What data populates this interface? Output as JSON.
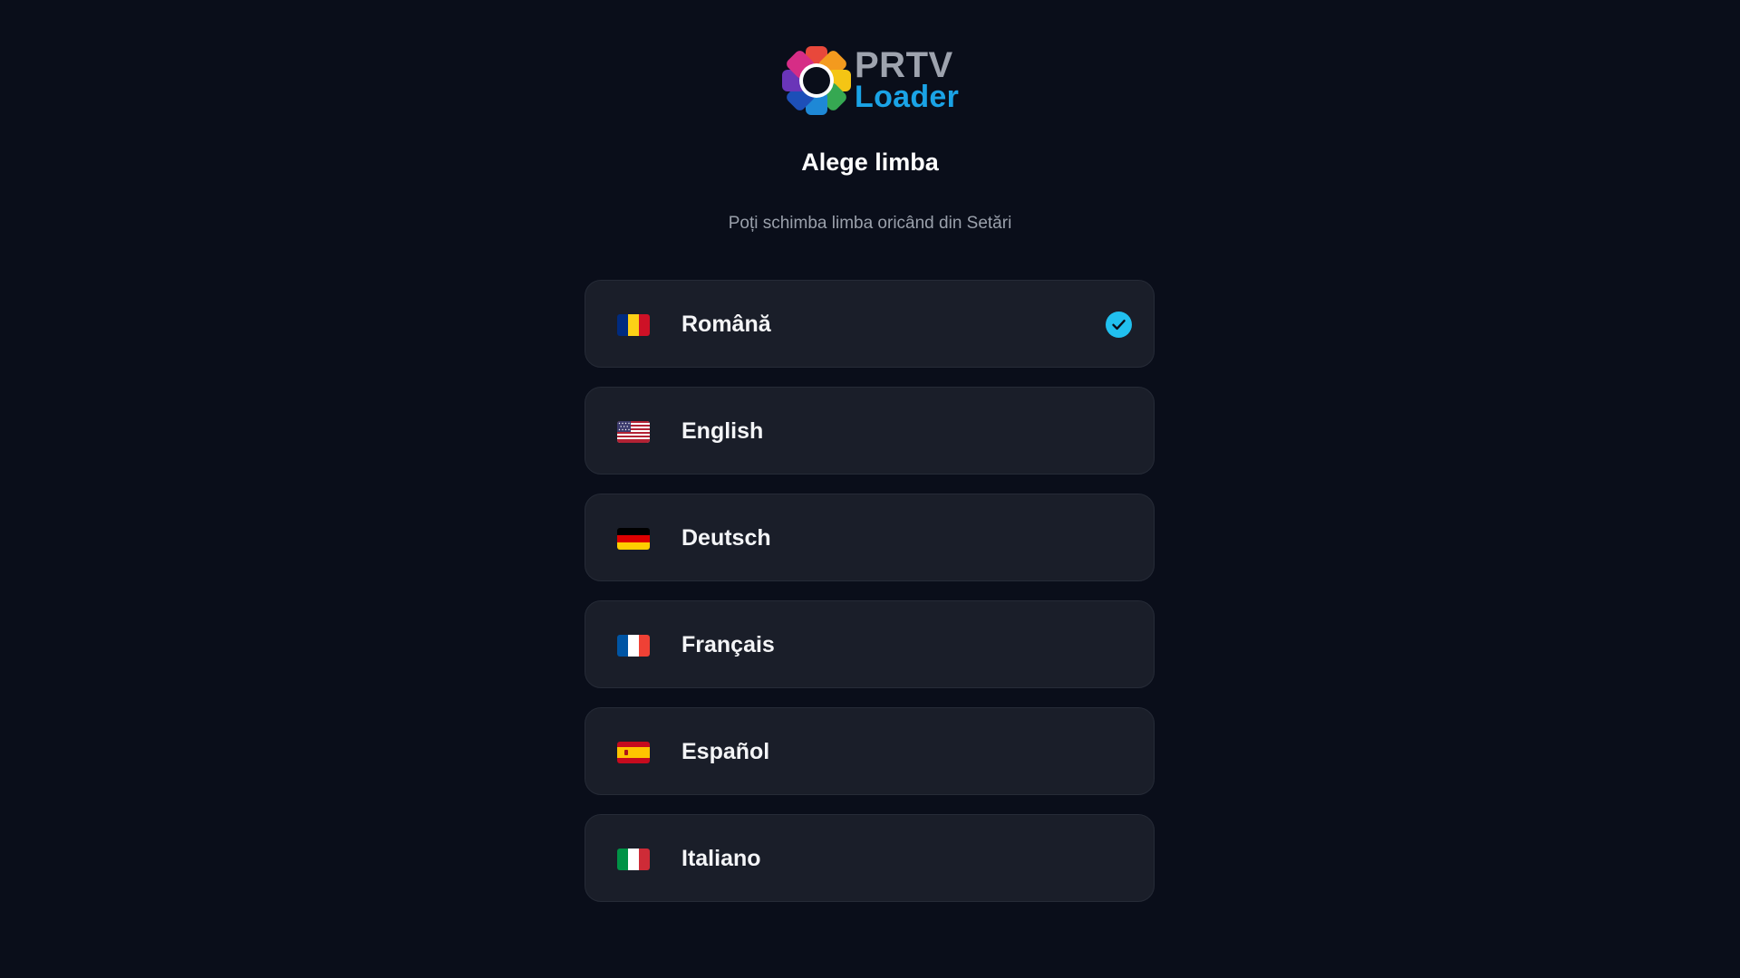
{
  "brand": {
    "name_line1": "PRTV",
    "name_line2": "Loader",
    "logo_icon": "prtv-flower-logo-icon",
    "colors": {
      "line1": "#9ea3ae",
      "line2": "#1aa3e6"
    }
  },
  "header": {
    "title": "Alege limba",
    "subtitle": "Poți schimba limba oricând din Setări"
  },
  "languages": [
    {
      "label": "Română",
      "flag_icon": "romania-flag-icon",
      "selected": true
    },
    {
      "label": "English",
      "flag_icon": "usa-flag-icon",
      "selected": false
    },
    {
      "label": "Deutsch",
      "flag_icon": "germany-flag-icon",
      "selected": false
    },
    {
      "label": "Français",
      "flag_icon": "france-flag-icon",
      "selected": false
    },
    {
      "label": "Español",
      "flag_icon": "spain-flag-icon",
      "selected": false
    },
    {
      "label": "Italiano",
      "flag_icon": "italy-flag-icon",
      "selected": false
    }
  ],
  "theme": {
    "background": "#0a0e1a",
    "card": "#1a1e29",
    "accent": "#21c0ef"
  }
}
